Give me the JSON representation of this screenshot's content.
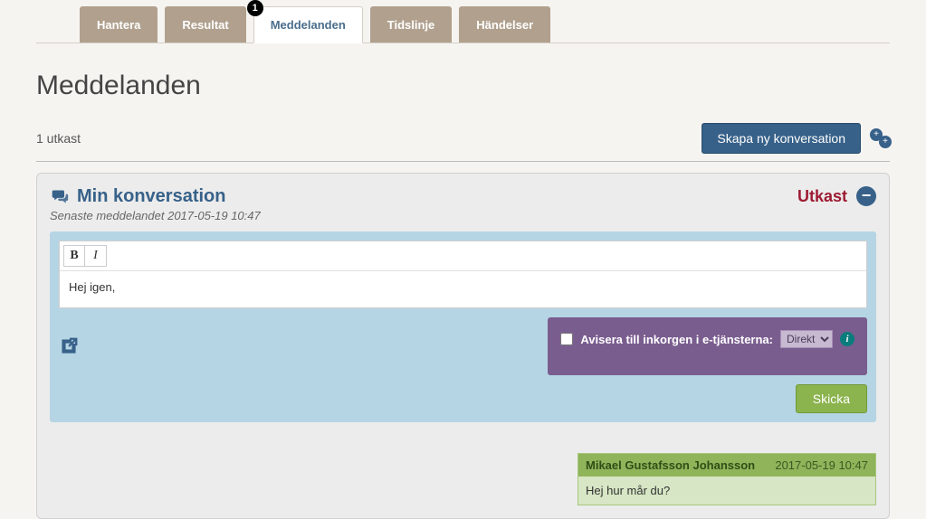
{
  "tabs": {
    "hantera": "Hantera",
    "resultat": "Resultat",
    "meddelanden": "Meddelanden",
    "tidslinje": "Tidslinje",
    "handelser": "Händelser",
    "badge_count": "1"
  },
  "page": {
    "title": "Meddelanden",
    "draft_count": "1 utkast",
    "new_conv_btn": "Skapa ny konversation"
  },
  "conversation": {
    "title": "Min konversation",
    "subtitle": "Senaste meddelandet 2017-05-19 10:47",
    "status": "Utkast",
    "editor_value": "Hej igen,",
    "toolbar": {
      "bold": "B",
      "italic": "I"
    },
    "avisera_label": "Avisera till inkorgen i e-tjänsterna:",
    "avisera_selected": "Direkt",
    "send_btn": "Skicka"
  },
  "thread": {
    "author": "Mikael Gustafsson Johansson",
    "timestamp": "2017-05-19 10:47",
    "body": "Hej hur mår du?"
  }
}
